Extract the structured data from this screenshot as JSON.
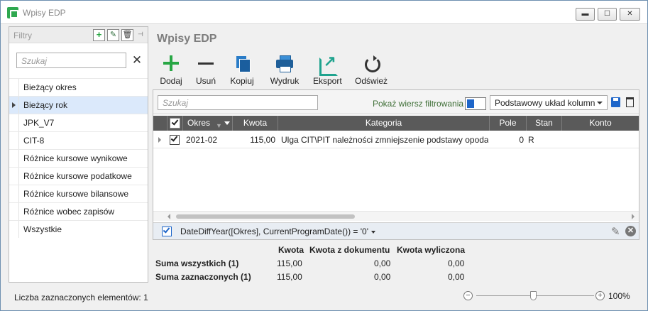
{
  "window": {
    "title": "Wpisy EDP",
    "minimize_glyph": "▬",
    "maximize_glyph": "☐",
    "close_glyph": "✕"
  },
  "filters": {
    "title": "Filtry",
    "add_glyph": "+",
    "edit_glyph": "✎",
    "delete_glyph": "🗑",
    "pin_glyph": "⊣",
    "search_placeholder": "Szukaj",
    "clear_glyph": "✕",
    "items": [
      {
        "label": "Bieżący okres"
      },
      {
        "label": "Bieżący rok"
      },
      {
        "label": "JPK_V7"
      },
      {
        "label": "CIT-8"
      },
      {
        "label": "Różnice kursowe wynikowe"
      },
      {
        "label": "Różnice kursowe podatkowe"
      },
      {
        "label": "Różnice kursowe bilansowe"
      },
      {
        "label": "Różnice wobec zapisów"
      },
      {
        "label": "Wszystkie"
      }
    ],
    "selected_index": 1
  },
  "main": {
    "title": "Wpisy EDP",
    "toolbar": [
      {
        "label": "Dodaj",
        "icon": "plus-icon"
      },
      {
        "label": "Usuń",
        "icon": "minus-icon"
      },
      {
        "label": "Kopiuj",
        "icon": "copy-icon"
      },
      {
        "label": "Wydruk",
        "icon": "printer-icon"
      },
      {
        "label": "Eksport",
        "icon": "export-icon"
      },
      {
        "label": "Odśwież",
        "icon": "refresh-icon"
      }
    ],
    "grid_search_placeholder": "Szukaj",
    "show_filter_row_label": "Pokaż wiersz filtrowania",
    "layout_select_value": "Podstawowy układ kolumn",
    "columns": [
      "Okres",
      "Kwota",
      "Kategoria",
      "Pole",
      "Stan",
      "Konto"
    ],
    "rows": [
      {
        "checked": true,
        "okres": "2021-02",
        "kwota": "115,00",
        "kategoria": "Ulga CIT\\PIT należności zmniejszenie podstawy opodatk",
        "pole": "0",
        "stan": "R",
        "konto": ""
      }
    ],
    "filter_expression": "DateDiffYear([Okres], CurrentProgramDate()) = '0'",
    "filter_enabled": true,
    "clear_filter_glyph": "✕",
    "edit_filter_glyph": "✎"
  },
  "summary": {
    "headers": [
      "Kwota",
      "Kwota z dokumentu",
      "Kwota wyliczona"
    ],
    "rows": [
      {
        "label": "Suma wszystkich (1)",
        "kwota": "115,00",
        "kwota_dok": "0,00",
        "kwota_wyl": "0,00"
      },
      {
        "label": "Suma zaznaczonych (1)",
        "kwota": "115,00",
        "kwota_dok": "0,00",
        "kwota_wyl": "0,00"
      }
    ]
  },
  "status": {
    "selected_count_text": "Liczba zaznaczonych elementów: 1"
  },
  "zoom": {
    "minus_glyph": "−",
    "plus_glyph": "+",
    "value": "100%",
    "level_fraction": 0.5
  },
  "colors": {
    "accent": "#1e66c9",
    "add_green": "#28a745",
    "header_bg": "#5a5a5a",
    "selected_row": "#dbe9fb"
  }
}
